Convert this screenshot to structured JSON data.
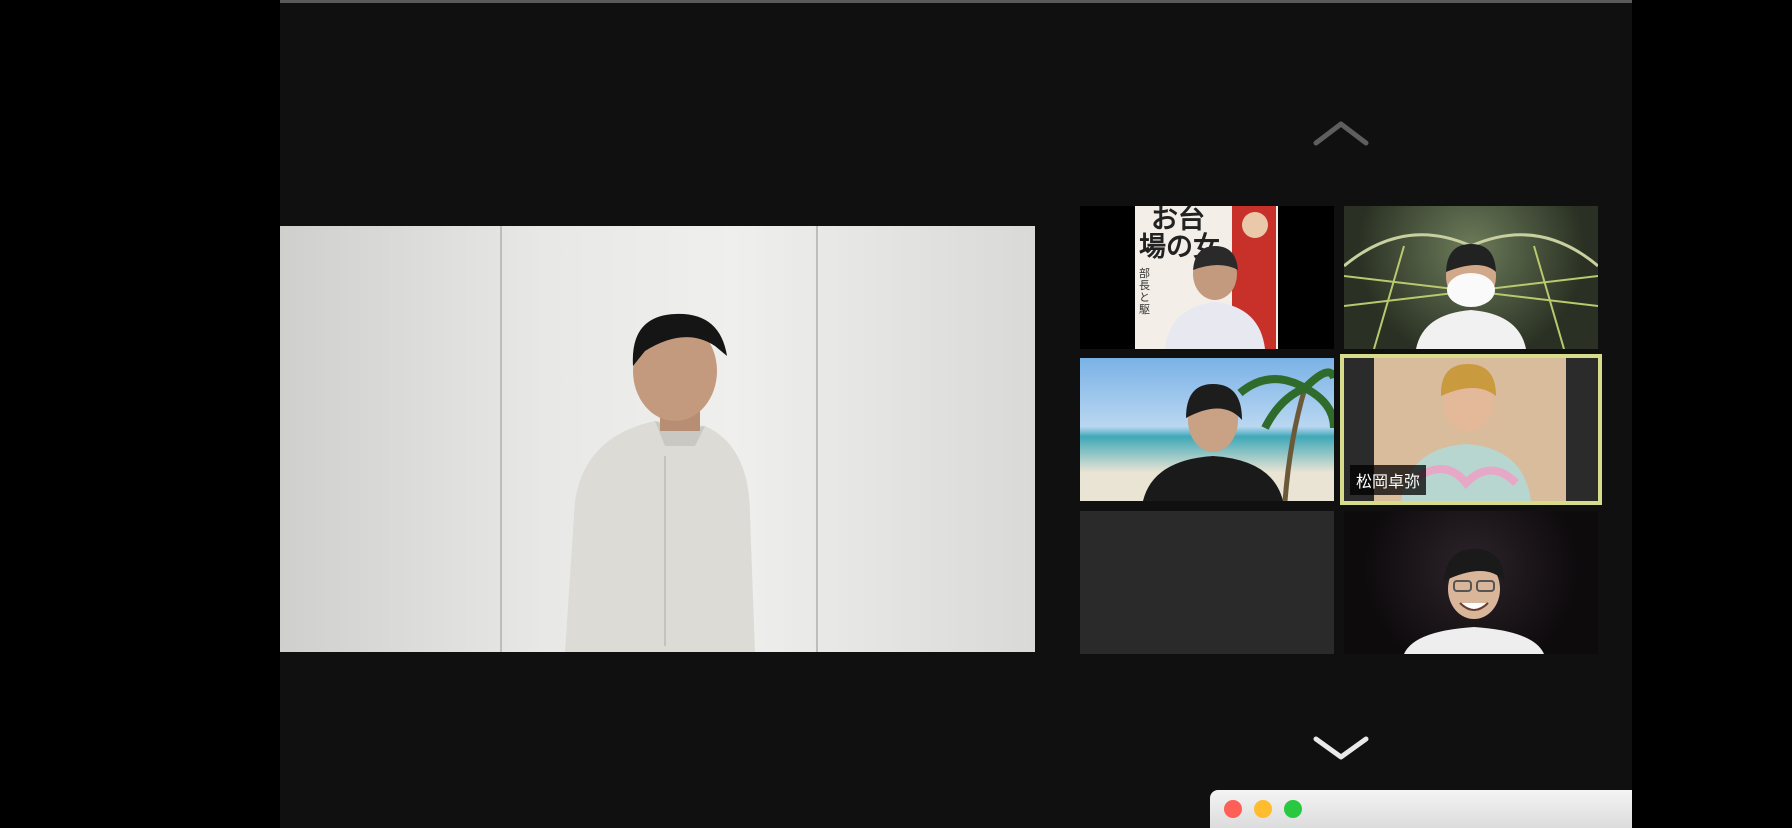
{
  "featured": {
    "participant": "main-speaker"
  },
  "gallery": {
    "scroll_up_icon": "chevron-up-icon",
    "scroll_down_icon": "chevron-down-icon",
    "tiles": [
      {
        "id": "poster-participant",
        "name": ""
      },
      {
        "id": "masked-participant",
        "name": ""
      },
      {
        "id": "beach-participant",
        "name": ""
      },
      {
        "id": "active-speaker",
        "name": "松岡卓弥",
        "active": true
      },
      {
        "id": "camera-off",
        "name": ""
      },
      {
        "id": "dark-room-participant",
        "name": ""
      }
    ],
    "active_border_color": "#d6dc8a"
  },
  "poster": {
    "title_line1": "お台",
    "title_line2": "場の女",
    "subtitle": "部長と駆"
  },
  "window_controls": {
    "close_color": "#fe5f57",
    "minimize_color": "#febc2e",
    "zoom_color": "#28c840"
  }
}
